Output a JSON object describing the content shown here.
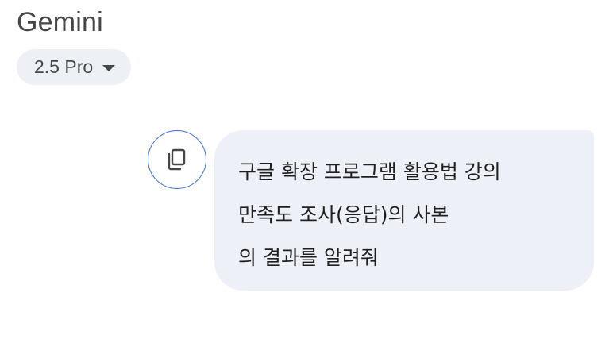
{
  "header": {
    "app_title": "Gemini",
    "model_selector": {
      "label": "2.5 Pro",
      "icon": "caret-down-icon"
    }
  },
  "conversation": {
    "user_message": {
      "lines": [
        "구글 확장 프로그램 활용법 강의",
        "만족도 조사(응답)의 사본",
        "의 결과를 알려줘"
      ],
      "copy_action": {
        "icon": "copy-icon"
      }
    }
  },
  "colors": {
    "bubble_background": "#edf0f7",
    "selector_background": "#edf0f5",
    "copy_button_border": "#3a6fd8",
    "title_text": "#444746"
  }
}
